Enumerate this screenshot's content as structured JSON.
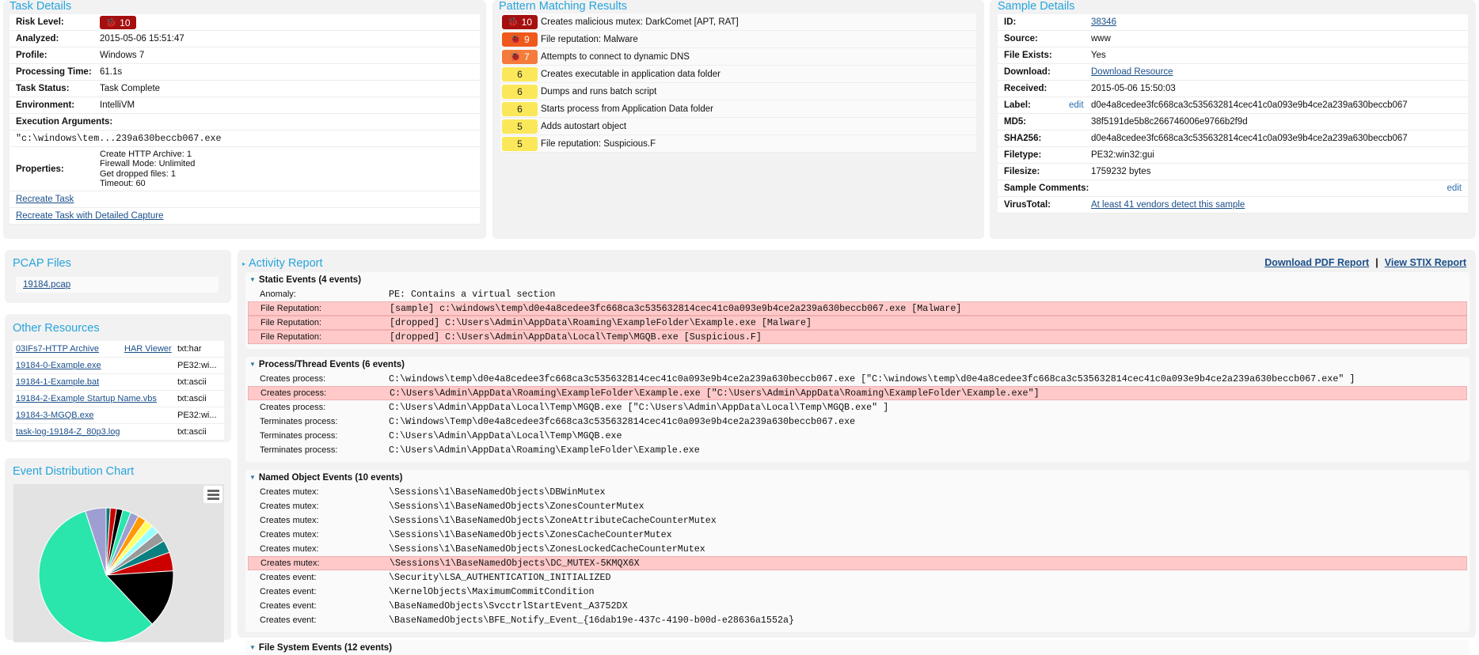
{
  "task_details": {
    "title": "Task Details",
    "risk_level": {
      "label": "Risk Level:",
      "value": "10",
      "color": "#a50f0f",
      "icon": "bug-icon"
    },
    "rows": [
      {
        "label": "Analyzed:",
        "value": "2015-05-06 15:51:47"
      },
      {
        "label": "Profile:",
        "value": "Windows 7"
      },
      {
        "label": "Processing Time:",
        "value": "61.1s"
      },
      {
        "label": "Task Status:",
        "value": "Task Complete"
      },
      {
        "label": "Environment:",
        "value": "IntelliVM"
      }
    ],
    "execution_arguments_label": "Execution Arguments:",
    "execution_arguments": "\"c:\\windows\\tem...239a630beccb067.exe",
    "properties_label": "Properties:",
    "properties": [
      "Create HTTP Archive: 1",
      "Firewall Mode: Unlimited",
      "Get dropped files: 1",
      "Timeout: 60"
    ],
    "recreate_task": "Recreate Task",
    "recreate_detailed": "Recreate Task with Detailed Capture"
  },
  "pattern_matching": {
    "title": "Pattern Matching Results",
    "items": [
      {
        "score": "10",
        "text": "Creates malicious mutex: DarkComet [APT, RAT]",
        "color": "#a50f0f",
        "icon": "bug-icon"
      },
      {
        "score": "9",
        "text": "File reputation: Malware",
        "color": "#f0591c",
        "icon": "bug-icon"
      },
      {
        "score": "7",
        "text": "Attempts to connect to dynamic DNS",
        "color": "#f47b3c",
        "icon": "bug-icon"
      },
      {
        "score": "6",
        "text": "Creates executable in application data folder",
        "color": "#fbe85a"
      },
      {
        "score": "6",
        "text": "Dumps and runs batch script",
        "color": "#fbe85a"
      },
      {
        "score": "6",
        "text": "Starts process from Application Data folder",
        "color": "#fbe85a"
      },
      {
        "score": "5",
        "text": "Adds autostart object",
        "color": "#fbe85a"
      },
      {
        "score": "5",
        "text": "File reputation: Suspicious.F",
        "color": "#fbe85a"
      }
    ]
  },
  "sample_details": {
    "title": "Sample Details",
    "edit": "edit",
    "rows": [
      {
        "label": "ID:",
        "value": "38346",
        "link": true
      },
      {
        "label": "Source:",
        "value": "www"
      },
      {
        "label": "File Exists:",
        "value": "Yes"
      },
      {
        "label": "Download:",
        "value": "Download Resource",
        "link": true
      },
      {
        "label": "Received:",
        "value": "2015-05-06 15:50:03"
      },
      {
        "label": "Label:",
        "value": "d0e4a8cedee3fc668ca3c535632814cec41c0a093e9b4ce2a239a630beccb067",
        "edit": true
      },
      {
        "label": "MD5:",
        "value": "38f5191de5b8c266746006e9766b2f9d"
      },
      {
        "label": "SHA256:",
        "value": "d0e4a8cedee3fc668ca3c535632814cec41c0a093e9b4ce2a239a630beccb067"
      },
      {
        "label": "Filetype:",
        "value": "PE32:win32:gui"
      },
      {
        "label": "Filesize:",
        "value": "1759232 bytes"
      },
      {
        "label": "Sample Comments:",
        "value": "",
        "edit_right": true
      },
      {
        "label": "VirusTotal:",
        "value": "At least 41 vendors detect this sample",
        "link": true
      }
    ]
  },
  "pcap": {
    "title": "PCAP Files",
    "files": [
      "19184.pcap"
    ]
  },
  "other_resources": {
    "title": "Other Resources",
    "items": [
      {
        "name": "03IFs7-HTTP Archive",
        "viewer": "HAR Viewer",
        "type": "txt:har"
      },
      {
        "name": "19184-0-Example.exe",
        "type": "PE32:wi..."
      },
      {
        "name": "19184-1-Example.bat",
        "type": "txt:ascii"
      },
      {
        "name": "19184-2-Example Startup Name.vbs",
        "type": "txt:ascii"
      },
      {
        "name": "19184-3-MGQB.exe",
        "type": "PE32:wi..."
      },
      {
        "name": "task-log-19184-Z_80p3.log",
        "type": "txt:ascii"
      }
    ]
  },
  "event_chart": {
    "title": "Event Distribution Chart",
    "menu_icon": "hamburger-menu-icon"
  },
  "chart_data": {
    "type": "pie",
    "title": "",
    "values": [
      1,
      1.5,
      1.5,
      2,
      2,
      2,
      2,
      2,
      2.5,
      3,
      4.5,
      14,
      57,
      5
    ],
    "colors": [
      "#0f7a7a",
      "#cc0000",
      "#000000",
      "#2ae6ac",
      "#9e9ed2",
      "#ff9900",
      "#ffff66",
      "#99ffff",
      "#999999",
      "#0a8080",
      "#cc0000",
      "#000000",
      "#2ae6ac",
      "#9e9ed2"
    ],
    "start_angle": "top, clockwise"
  },
  "activity": {
    "title": "Activity Report",
    "download_pdf": "Download PDF Report",
    "separator": "|",
    "view_stix": "View STIX Report",
    "sections": [
      {
        "title": "Static Events (4 events)",
        "events": [
          {
            "label": "Anomaly:",
            "value": "PE: Contains a virtual section",
            "hl": false
          },
          {
            "label": "File Reputation:",
            "value": "[sample] c:\\windows\\temp\\d0e4a8cedee3fc668ca3c535632814cec41c0a093e9b4ce2a239a630beccb067.exe [Malware]",
            "hl": true
          },
          {
            "label": "File Reputation:",
            "value": "[dropped] C:\\Users\\Admin\\AppData\\Roaming\\ExampleFolder\\Example.exe [Malware]",
            "hl": true
          },
          {
            "label": "File Reputation:",
            "value": "[dropped] C:\\Users\\Admin\\AppData\\Local\\Temp\\MGQB.exe [Suspicious.F]",
            "hl": true
          }
        ]
      },
      {
        "title": "Process/Thread Events (6 events)",
        "events": [
          {
            "label": "Creates process:",
            "value": "C:\\windows\\temp\\d0e4a8cedee3fc668ca3c535632814cec41c0a093e9b4ce2a239a630beccb067.exe [\"C:\\windows\\temp\\d0e4a8cedee3fc668ca3c535632814cec41c0a093e9b4ce2a239a630beccb067.exe\" ]",
            "hl": false
          },
          {
            "label": "Creates process:",
            "value": "C:\\Users\\Admin\\AppData\\Roaming\\ExampleFolder\\Example.exe [\"C:\\Users\\Admin\\AppData\\Roaming\\ExampleFolder\\Example.exe\"]",
            "hl": true
          },
          {
            "label": "Creates process:",
            "value": "C:\\Users\\Admin\\AppData\\Local\\Temp\\MGQB.exe [\"C:\\Users\\Admin\\AppData\\Local\\Temp\\MGQB.exe\" ]",
            "hl": false
          },
          {
            "label": "Terminates process:",
            "value": "C:\\Windows\\Temp\\d0e4a8cedee3fc668ca3c535632814cec41c0a093e9b4ce2a239a630beccb067.exe",
            "hl": false
          },
          {
            "label": "Terminates process:",
            "value": "C:\\Users\\Admin\\AppData\\Local\\Temp\\MGQB.exe",
            "hl": false
          },
          {
            "label": "Terminates process:",
            "value": "C:\\Users\\Admin\\AppData\\Roaming\\ExampleFolder\\Example.exe",
            "hl": false
          }
        ]
      },
      {
        "title": "Named Object Events (10 events)",
        "events": [
          {
            "label": "Creates mutex:",
            "value": "\\Sessions\\1\\BaseNamedObjects\\DBWinMutex",
            "hl": false
          },
          {
            "label": "Creates mutex:",
            "value": "\\Sessions\\1\\BaseNamedObjects\\ZonesCounterMutex",
            "hl": false
          },
          {
            "label": "Creates mutex:",
            "value": "\\Sessions\\1\\BaseNamedObjects\\ZoneAttributeCacheCounterMutex",
            "hl": false
          },
          {
            "label": "Creates mutex:",
            "value": "\\Sessions\\1\\BaseNamedObjects\\ZonesCacheCounterMutex",
            "hl": false
          },
          {
            "label": "Creates mutex:",
            "value": "\\Sessions\\1\\BaseNamedObjects\\ZonesLockedCacheCounterMutex",
            "hl": false
          },
          {
            "label": "Creates mutex:",
            "value": "\\Sessions\\1\\BaseNamedObjects\\DC_MUTEX-5KMQX6X",
            "hl": true
          },
          {
            "label": "Creates event:",
            "value": "\\Security\\LSA_AUTHENTICATION_INITIALIZED",
            "hl": false
          },
          {
            "label": "Creates event:",
            "value": "\\KernelObjects\\MaximumCommitCondition",
            "hl": false
          },
          {
            "label": "Creates event:",
            "value": "\\BaseNamedObjects\\SvcctrlStartEvent_A3752DX",
            "hl": false
          },
          {
            "label": "Creates event:",
            "value": "\\BaseNamedObjects\\BFE_Notify_Event_{16dab19e-437c-4190-b00d-e28636a1552a}",
            "hl": false
          }
        ]
      },
      {
        "title": "File System Events (12 events)",
        "events": []
      }
    ]
  }
}
